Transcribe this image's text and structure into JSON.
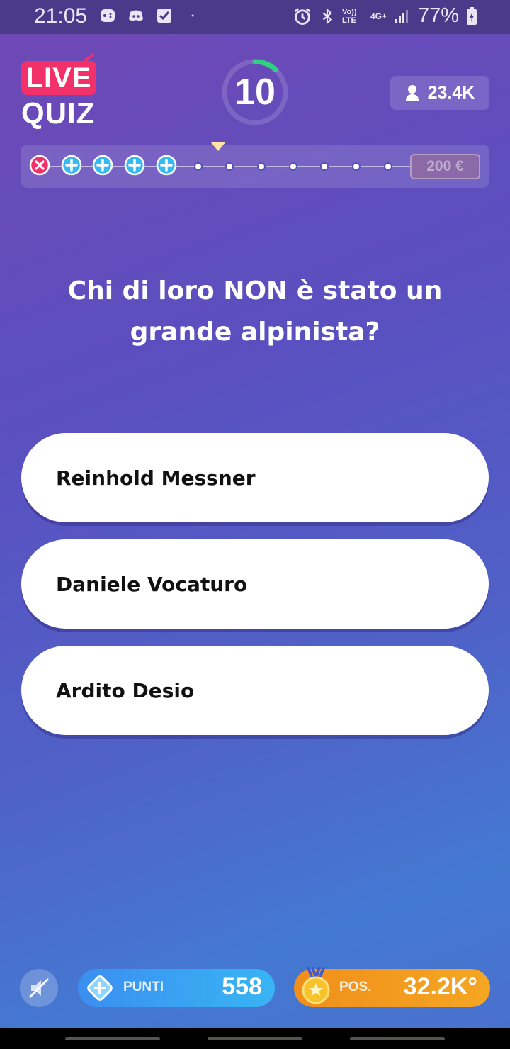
{
  "status_bar": {
    "time": "21:05",
    "battery": "77%",
    "left_icons": [
      "game-icon",
      "discord-icon",
      "check-icon",
      "dot-icon"
    ],
    "right_icons": [
      "alarm-icon",
      "bluetooth-icon",
      "volte-icon",
      "4g-icon",
      "signal-icon",
      "battery-icon"
    ],
    "volte_label": "Vo)) LTE",
    "network_label": "4G+"
  },
  "header": {
    "logo_top": "LIVE",
    "logo_bottom": "QUIZ",
    "timer": "10",
    "timer_remaining_fraction": 0.12,
    "viewers": "23.4K"
  },
  "progress": {
    "answered": [
      "wrong",
      "correct",
      "correct",
      "correct",
      "correct"
    ],
    "current_index": 5,
    "total": 12,
    "prize": "200 €"
  },
  "question": {
    "text": "Chi di loro NON è stato un grande alpinista?"
  },
  "answers": [
    {
      "label": "Reinhold Messner"
    },
    {
      "label": "Daniele Vocaturo"
    },
    {
      "label": "Ardito Desio"
    }
  ],
  "footer": {
    "points_label": "PUNTI",
    "points_value": "558",
    "position_label": "POS.",
    "position_value": "32.2K°"
  },
  "colors": {
    "accent_pink": "#f2306a",
    "timer_green": "#2fd27f",
    "points_blue": "#3b8ef0",
    "position_orange": "#f08f1a"
  }
}
